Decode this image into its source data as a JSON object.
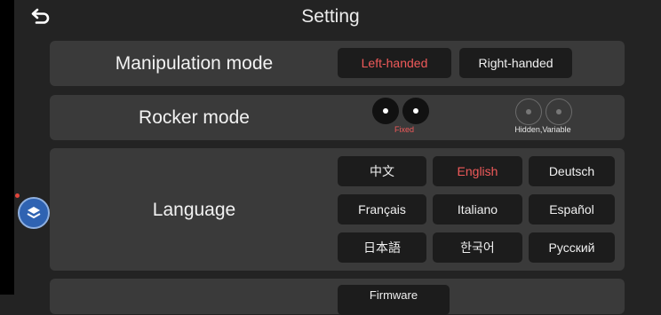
{
  "header": {
    "title": "Setting",
    "back_icon": "back-arrow-icon"
  },
  "manipulation": {
    "label": "Manipulation mode",
    "options": [
      "Left-handed",
      "Right-handed"
    ],
    "selected": "Left-handed"
  },
  "rocker": {
    "label": "Rocker mode",
    "fixed_caption": "Fixed",
    "hidden_caption": "Hidden,Variable",
    "selected": "Fixed"
  },
  "language": {
    "label": "Language",
    "options": [
      "中文",
      "English",
      "Deutsch",
      "Français",
      "Italiano",
      "Español",
      "日本語",
      "한국어",
      "Русский"
    ],
    "selected": "English"
  },
  "firmware": {
    "label": "Firmware"
  },
  "colors": {
    "accent": "#f05a5a",
    "panel": "#3a3a3a",
    "button": "#1c1c1c",
    "float": "#2f63b2"
  }
}
